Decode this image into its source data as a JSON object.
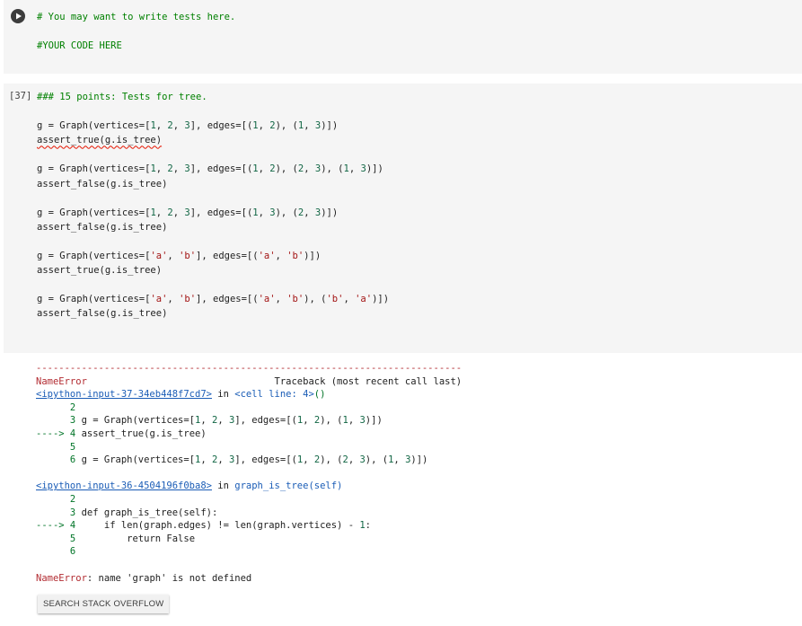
{
  "cell1": {
    "run_icon": "play-icon",
    "lines": [
      "# You may want to write tests here.",
      "",
      "#YOUR CODE HERE"
    ]
  },
  "cell2": {
    "execution_count": "[37]",
    "lines": [
      "### 15 points: Tests for tree.",
      "",
      "g = Graph(vertices=[1, 2, 3], edges=[(1, 2), (1, 3)])",
      "assert_true(g.is_tree)",
      "",
      "g = Graph(vertices=[1, 2, 3], edges=[(1, 2), (2, 3), (1, 3)])",
      "assert_false(g.is_tree)",
      "",
      "g = Graph(vertices=[1, 2, 3], edges=[(1, 3), (2, 3)])",
      "assert_false(g.is_tree)",
      "",
      "g = Graph(vertices=['a', 'b'], edges=[('a', 'b')])",
      "assert_true(g.is_tree)",
      "",
      "g = Graph(vertices=['a', 'b'], edges=[('a', 'b'), ('b', 'a')])",
      "assert_false(g.is_tree)"
    ]
  },
  "output": {
    "separator": "---------------------------------------------------------------------------",
    "error_name": "NameError",
    "traceback_header": "Traceback (most recent call last)",
    "frame1_link": "<ipython-input-37-34eb448f7cd7>",
    "frame1_in": " in ",
    "frame1_loc": "<cell line: 4>",
    "frame1_paren": "()",
    "frame1_lines": [
      {
        "prefix": "      ",
        "num": "2",
        "code": ""
      },
      {
        "prefix": "      ",
        "num": "3",
        "code": " g = Graph(vertices=[1, 2, 3], edges=[(1, 2), (1, 3)])"
      },
      {
        "prefix": "----> ",
        "num": "4",
        "code": " assert_true(g.is_tree)"
      },
      {
        "prefix": "      ",
        "num": "5",
        "code": ""
      },
      {
        "prefix": "      ",
        "num": "6",
        "code": " g = Graph(vertices=[1, 2, 3], edges=[(1, 2), (2, 3), (1, 3)])"
      }
    ],
    "frame2_link": "<ipython-input-36-4504196f0ba8>",
    "frame2_in": " in ",
    "frame2_loc": "graph_is_tree(self)",
    "frame2_lines": [
      {
        "prefix": "      ",
        "num": "2",
        "code": ""
      },
      {
        "prefix": "      ",
        "num": "3",
        "code": " def graph_is_tree(self):"
      },
      {
        "prefix": "----> ",
        "num": "4",
        "code": "     if len(graph.edges) != len(graph.vertices) - 1:"
      },
      {
        "prefix": "      ",
        "num": "5",
        "code": "         return False"
      },
      {
        "prefix": "      ",
        "num": "6",
        "code": ""
      }
    ],
    "final_error_name": "NameError",
    "final_error_msg": ": name 'graph' is not defined"
  },
  "stack_overflow_button": "SEARCH STACK OVERFLOW"
}
